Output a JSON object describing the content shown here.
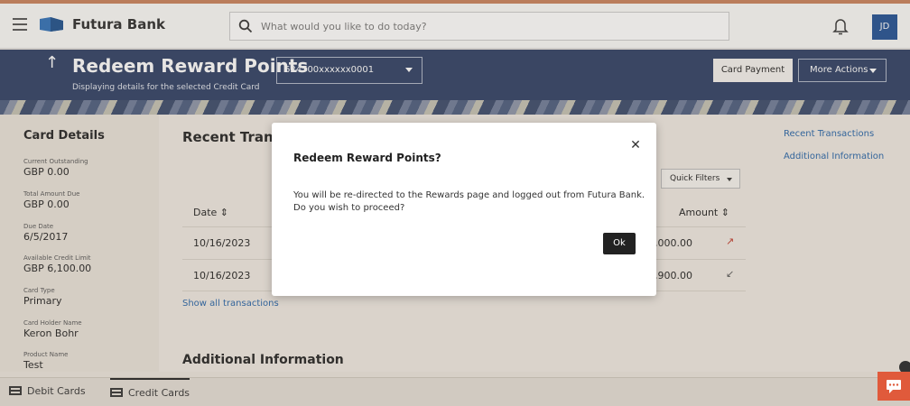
{
  "header": {
    "brand": "Futura Bank",
    "search_placeholder": "What would you like to do today?",
    "avatar_initials": "JD"
  },
  "banner": {
    "title": "Redeem Reward Points",
    "subtitle": "Displaying details for the selected Credit Card",
    "card_number": "624700xxxxxx0001",
    "card_payment_label": "Card Payment",
    "more_actions_label": "More Actions"
  },
  "card_details": {
    "title": "Card Details",
    "fields": [
      {
        "label": "Current Outstanding",
        "value": "GBP 0.00"
      },
      {
        "label": "Total Amount Due",
        "value": "GBP 0.00"
      },
      {
        "label": "Due Date",
        "value": "6/5/2017"
      },
      {
        "label": "Available Credit Limit",
        "value": "GBP 6,100.00"
      },
      {
        "label": "Card Type",
        "value": "Primary"
      },
      {
        "label": "Card Holder Name",
        "value": "Keron Bohr"
      },
      {
        "label": "Product Name",
        "value": "Test"
      }
    ]
  },
  "recent": {
    "title": "Recent Trans",
    "quick_filters": "Quick Filters",
    "col_date": "Date",
    "col_amount": "Amount",
    "rows": [
      {
        "date": "10/16/2023",
        "amount": "0,000.00",
        "direction": "↗"
      },
      {
        "date": "10/16/2023",
        "amount": "2,900.00",
        "direction": "↙"
      }
    ],
    "show_all": "Show all transactions"
  },
  "additional_info_title": "Additional Information",
  "side_links": {
    "recent": "Recent Transactions",
    "additional": "Additional Information"
  },
  "modal": {
    "title": "Redeem Reward Points?",
    "message": "You will be re-directed to the Rewards page and logged out from Futura Bank. Do you wish to proceed?",
    "ok_label": "Ok"
  },
  "bottom_tabs": {
    "debit": "Debit Cards",
    "credit": "Credit Cards"
  },
  "colors": {
    "banner": "#2c3e63",
    "accent": "#c9805a",
    "link": "#2563a8",
    "chat": "#e05a3b"
  }
}
